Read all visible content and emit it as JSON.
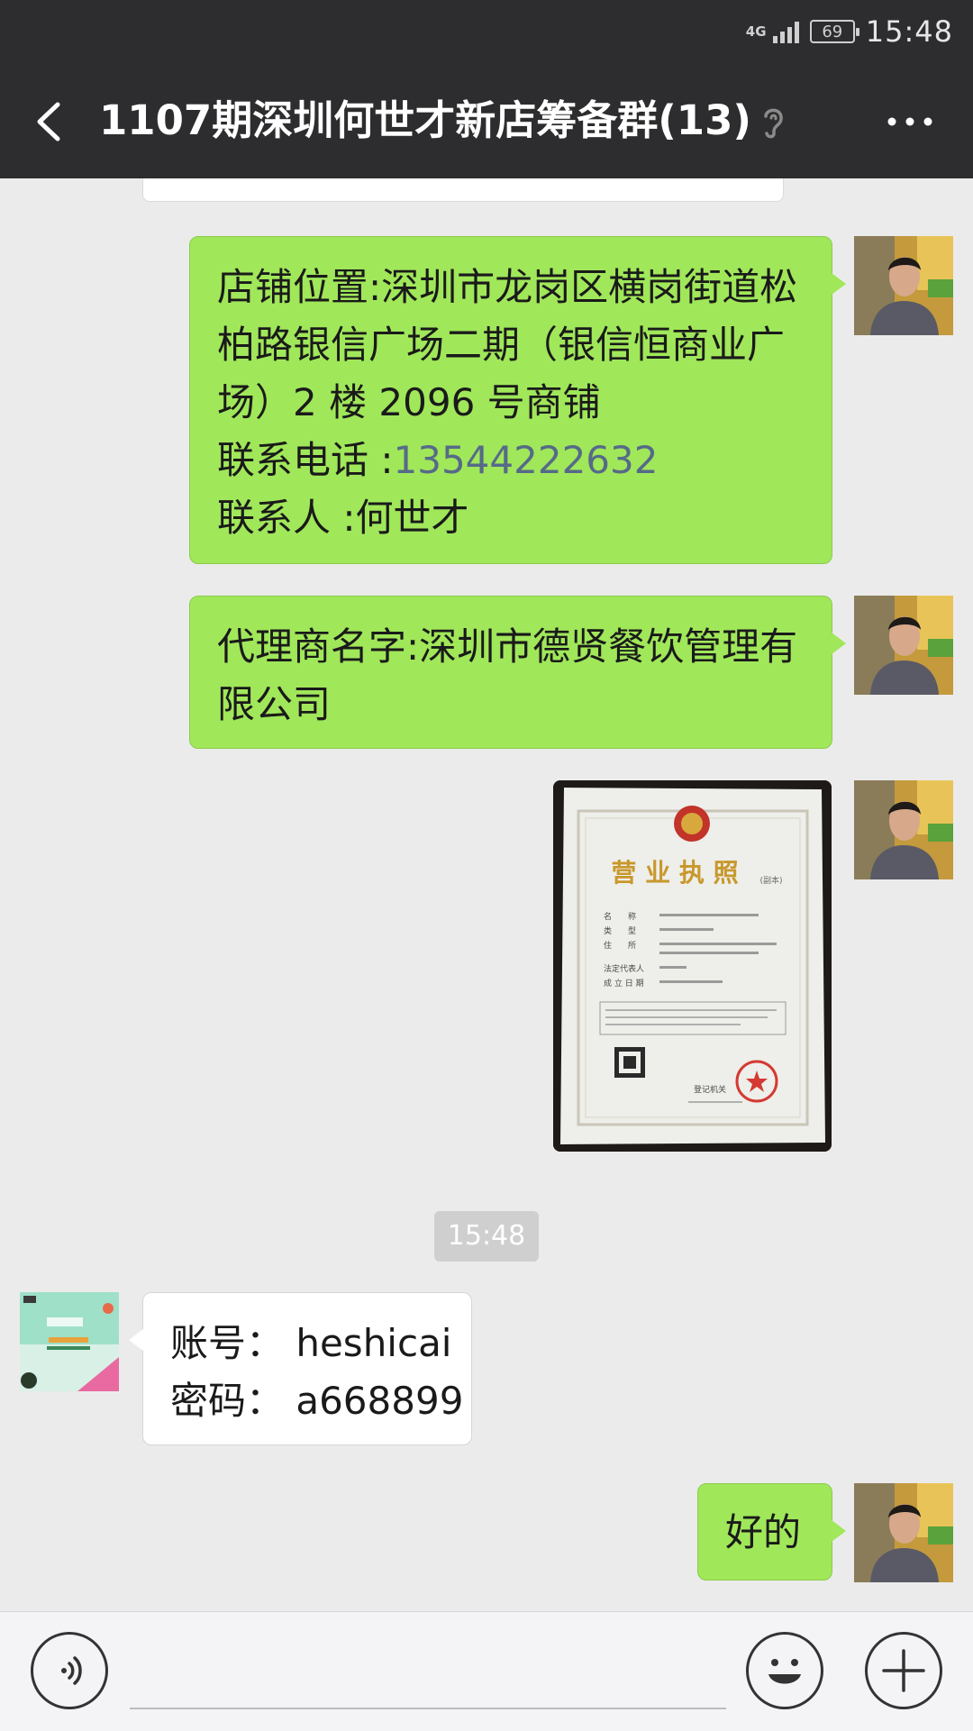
{
  "status_bar": {
    "network": "4G",
    "battery": "69",
    "time": "15:48"
  },
  "nav": {
    "title": "1107期深圳何世才新店筹备群(13)"
  },
  "messages": {
    "m1": {
      "line1": "店铺位置:深圳市龙岗区横岗街道松",
      "line2": "柏路银信广场二期（银信恒商业广",
      "line3": "场）2 楼 2096 号商铺",
      "line4_label": "联系电话 :",
      "line4_phone": "13544222632",
      "line5": "联系人 :何世才"
    },
    "m2": {
      "line1": "代理商名字:深圳市德贤餐饮管理有",
      "line2": "限公司"
    },
    "license": {
      "title": "营 业 执 照",
      "subtitle": "(副本)",
      "field1": "名　　称",
      "field2": "类　　型",
      "field3": "住　　所",
      "field4": "法定代表人",
      "field5": "成 立 日 期",
      "authority": "登记机关"
    },
    "timestamp": "15:48",
    "m3": {
      "line1": "账号：  heshicai",
      "line2": "密码：  a668899"
    },
    "m4": {
      "text": "好的"
    }
  },
  "colors": {
    "header_bg": "#2d2d2f",
    "chat_bg": "#ebebeb",
    "bubble_green": "#a0e75a",
    "bubble_white": "#ffffff",
    "phone_link": "#566a88"
  },
  "icons": {
    "back": "chevron-left-icon",
    "ear": "ear-icon",
    "more": "more-dots-icon",
    "voice": "voice-icon",
    "emoji": "emoji-icon",
    "plus": "plus-icon"
  }
}
